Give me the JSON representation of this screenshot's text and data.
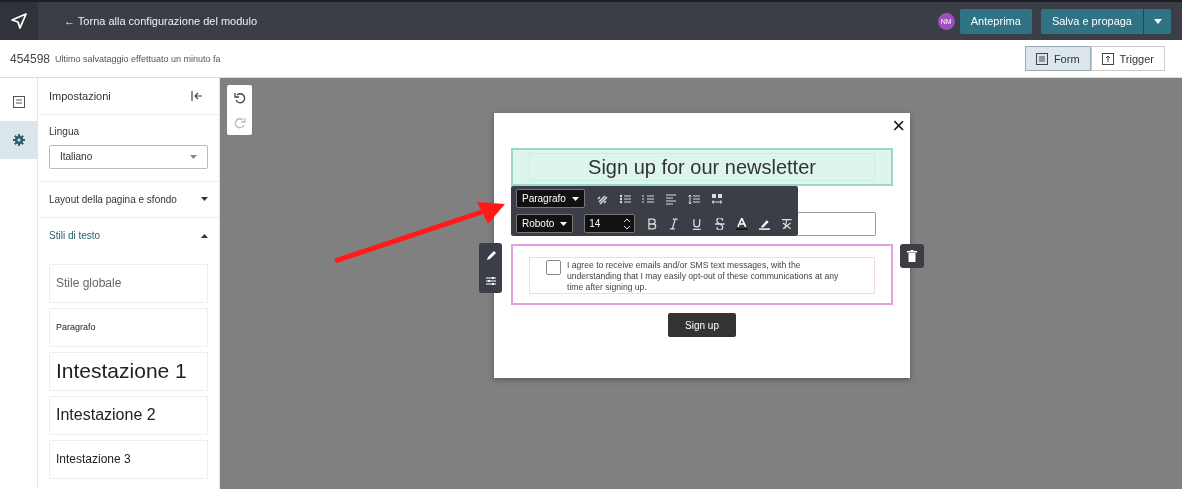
{
  "topbar": {
    "back_link": "← Torna alla configurazione del modulo",
    "avatar": "NM",
    "preview_button": "Anteprima",
    "save_button": "Salva e propaga"
  },
  "subheader": {
    "id": "454598",
    "status": "Ultimo salvataggio effettuato un minuto fa",
    "view_toggle": [
      {
        "label": "Form",
        "selected": true
      },
      {
        "label": "Trigger",
        "selected": false
      }
    ]
  },
  "rail": [
    {
      "kind": "content",
      "selected": false
    },
    {
      "kind": "settings",
      "selected": true
    }
  ],
  "sidebar": {
    "title": "Impostazioni",
    "language_label": "Lingua",
    "language_value": "Italiano",
    "sections": [
      {
        "label": "Layout della pagina e sfondo",
        "expanded": false
      },
      {
        "label": "Stili di testo",
        "expanded": true
      }
    ],
    "text_styles": [
      {
        "label": "Stile globale",
        "kind": "global"
      },
      {
        "label": "Paragrafo",
        "kind": "paragraph"
      },
      {
        "label": "Intestazione 1",
        "kind": "h1"
      },
      {
        "label": "Intestazione 2",
        "kind": "h2"
      },
      {
        "label": "Intestazione 3",
        "kind": "h3"
      }
    ]
  },
  "form": {
    "close": "×",
    "heading": "Sign up for our newsletter",
    "toolbar": {
      "block_type": "Paragrafo",
      "font": "Roboto",
      "size": "14"
    },
    "consent": {
      "checked": false,
      "text": "I agree to receive emails and/or SMS text messages, with the understanding that I may easily opt-out of these communications at any time after signing up."
    },
    "submit": "Sign up"
  }
}
